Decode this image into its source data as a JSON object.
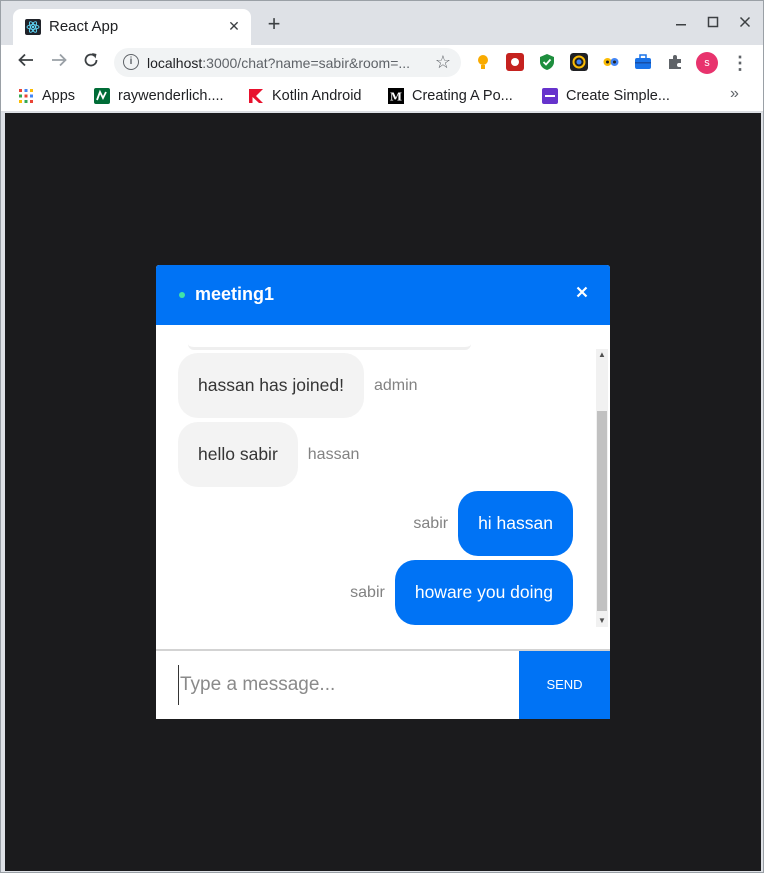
{
  "browser": {
    "tab_title": "React App",
    "tab_close": "✕",
    "new_tab": "+",
    "url_host": "localhost",
    "url_rest": ":3000/chat?name=sabir&room=...",
    "profile_initial": "s",
    "bookmarks": [
      {
        "label": "Apps",
        "icon": "apps-grid-icon"
      },
      {
        "label": "raywenderlich....",
        "icon": "raywenderlich-icon"
      },
      {
        "label": "Kotlin Android",
        "icon": "kotlin-icon"
      },
      {
        "label": "Creating A Po...",
        "icon": "medium-icon"
      },
      {
        "label": "Create Simple...",
        "icon": "bookmark-purple-icon"
      }
    ],
    "more_bookmarks": "»"
  },
  "chat": {
    "room_name": "meeting1",
    "close_label": "✕",
    "messages": [
      {
        "text": "hassan has joined!",
        "sender": "admin",
        "mine": false
      },
      {
        "text": "hello sabir",
        "sender": "hassan",
        "mine": false
      },
      {
        "text": "hi hassan",
        "sender": "sabir",
        "mine": true
      },
      {
        "text": "howare you doing",
        "sender": "sabir",
        "mine": true
      }
    ],
    "input_placeholder": "Type a message...",
    "input_value": "",
    "send_label": "SEND"
  },
  "colors": {
    "accent": "#0073f5",
    "online": "#41e3a8",
    "background": "#1b1b1d"
  }
}
